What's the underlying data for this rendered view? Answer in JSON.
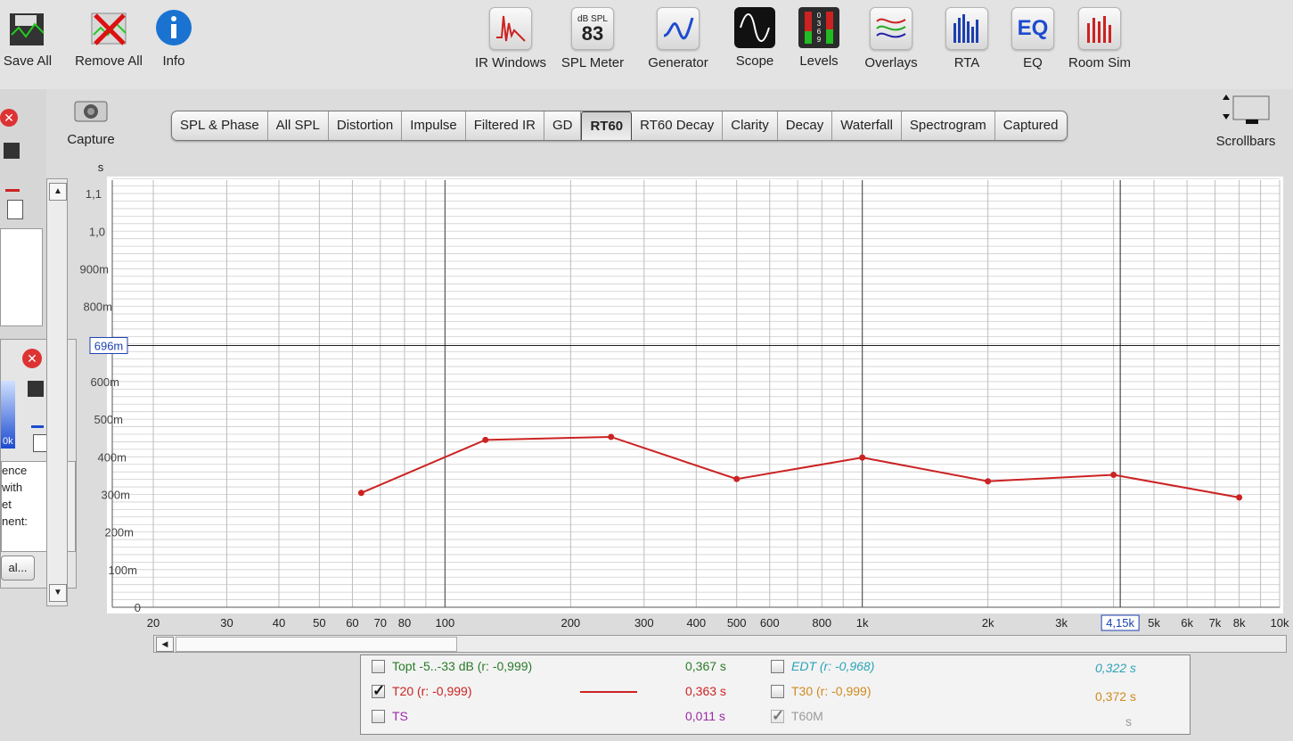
{
  "toolbar": {
    "save_all": "Save All",
    "remove_all": "Remove All",
    "info": "Info",
    "ir_windows": "IR Windows",
    "spl_meter": "SPL Meter",
    "spl_unit": "dB SPL",
    "spl_value": "83",
    "generator": "Generator",
    "scope": "Scope",
    "levels": "Levels",
    "levels_digits": "0 3 6 9",
    "overlays": "Overlays",
    "rta": "RTA",
    "eq": "EQ",
    "eq_icon_text": "EQ",
    "room_sim": "Room Sim",
    "capture": "Capture",
    "scrollbars": "Scrollbars"
  },
  "tabs": [
    "SPL & Phase",
    "All SPL",
    "Distortion",
    "Impulse",
    "Filtered IR",
    "GD",
    "RT60",
    "RT60 Decay",
    "Clarity",
    "Decay",
    "Waterfall",
    "Spectrogram",
    "Captured"
  ],
  "active_tab": "RT60",
  "left_panel": {
    "text_lines": [
      "ence",
      "with",
      "et",
      "nent:"
    ],
    "freq_snip": "0k",
    "button_snip": "al..."
  },
  "chart_data": {
    "type": "line",
    "ylabel": "s",
    "xscale": "log",
    "xlim": [
      20,
      10000
    ],
    "ylim": [
      0,
      1.15
    ],
    "y_ticks": [
      {
        "v": 0,
        "label": "0"
      },
      {
        "v": 0.1,
        "label": "100m"
      },
      {
        "v": 0.2,
        "label": "200m"
      },
      {
        "v": 0.3,
        "label": "300m"
      },
      {
        "v": 0.4,
        "label": "400m"
      },
      {
        "v": 0.5,
        "label": "500m"
      },
      {
        "v": 0.6,
        "label": "600m"
      },
      {
        "v": 0.8,
        "label": "800m"
      },
      {
        "v": 0.9,
        "label": "900m"
      },
      {
        "v": 1.0,
        "label": "1,0"
      },
      {
        "v": 1.1,
        "label": "1,1"
      }
    ],
    "x_ticks": [
      {
        "v": 20,
        "label": "20"
      },
      {
        "v": 30,
        "label": "30"
      },
      {
        "v": 40,
        "label": "40"
      },
      {
        "v": 50,
        "label": "50"
      },
      {
        "v": 60,
        "label": "60"
      },
      {
        "v": 70,
        "label": "70"
      },
      {
        "v": 80,
        "label": "80"
      },
      {
        "v": 100,
        "label": "100"
      },
      {
        "v": 200,
        "label": "200"
      },
      {
        "v": 300,
        "label": "300"
      },
      {
        "v": 400,
        "label": "400"
      },
      {
        "v": 500,
        "label": "500"
      },
      {
        "v": 600,
        "label": "600"
      },
      {
        "v": 800,
        "label": "800"
      },
      {
        "v": 1000,
        "label": "1k"
      },
      {
        "v": 2000,
        "label": "2k"
      },
      {
        "v": 3000,
        "label": "3k"
      },
      {
        "v": 5000,
        "label": "5k"
      },
      {
        "v": 6000,
        "label": "6k"
      },
      {
        "v": 7000,
        "label": "7k"
      },
      {
        "v": 8000,
        "label": "8k"
      },
      {
        "v": 10000,
        "label": "10k"
      }
    ],
    "cursor": {
      "x": 4150,
      "x_label": "4,15k",
      "y": 0.696,
      "y_label": "696m"
    },
    "series": [
      {
        "name": "T20 (r: -0,999)",
        "color": "#cc2222",
        "x": [
          63,
          125,
          250,
          500,
          1000,
          2000,
          4000,
          8000
        ],
        "y": [
          0.304,
          0.445,
          0.453,
          0.341,
          0.398,
          0.335,
          0.352,
          0.292
        ]
      }
    ]
  },
  "legend": {
    "rows": [
      {
        "label": "Topt -5..-33 dB (r: -0,999)",
        "value": "0,367 s",
        "checked": false,
        "color": "#2a7a2a"
      },
      {
        "label": "T20 (r: -0,999)",
        "value": "0,363 s",
        "checked": true,
        "color": "#cc2222"
      },
      {
        "label": "TS",
        "value": "0,011 s",
        "checked": false,
        "color": "#9a2aa6"
      },
      {
        "label": "EDT (r: -0,968)",
        "value": "0,322 s",
        "checked": false,
        "color": "#2aa3b8"
      },
      {
        "label": "T30 (r: -0,999)",
        "value": "0,372 s",
        "checked": false,
        "color": "#d08a20"
      },
      {
        "label": "T60M",
        "value": "s",
        "checked": true,
        "color": "#9a9a9a"
      }
    ]
  }
}
